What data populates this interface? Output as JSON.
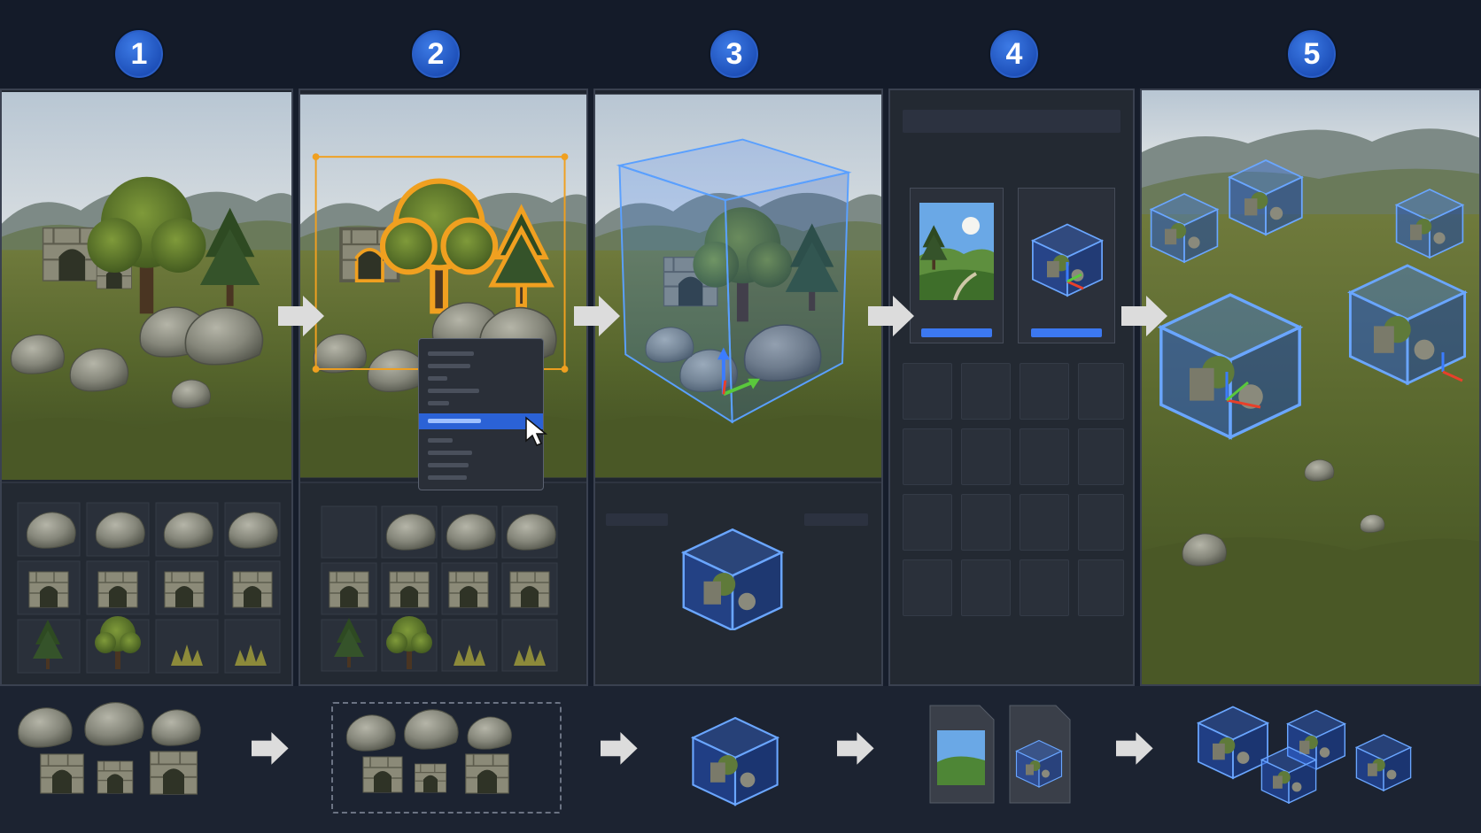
{
  "steps": [
    {
      "number": "1",
      "name": "step-1"
    },
    {
      "number": "2",
      "name": "step-2"
    },
    {
      "number": "3",
      "name": "step-3"
    },
    {
      "number": "4",
      "name": "step-4"
    },
    {
      "number": "5",
      "name": "step-5"
    }
  ],
  "colors": {
    "background": "#161d2b",
    "badge_blue": "#2a64d0",
    "selection_orange": "#f0a020",
    "prefab_blue": "#3c82ff",
    "menu_highlight": "#2b62d6",
    "arrow_grey": "#dcdcdc",
    "gizmo_red": "#e8402a",
    "gizmo_green": "#5ac83c",
    "gizmo_blue": "#3b7cff"
  },
  "icons": [
    "arrow-right-icon",
    "mouse-cursor-icon",
    "prefab-cube-icon",
    "prefab-file-icon",
    "scene-thumbnail-icon"
  ],
  "library_rows": [
    "rocks",
    "ruins",
    "vegetation"
  ]
}
